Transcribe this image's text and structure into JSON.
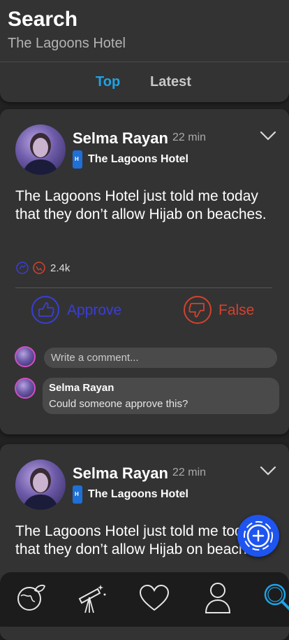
{
  "header": {
    "title": "Search",
    "query": "The Lagoons Hotel",
    "tabs": [
      {
        "label": "Top",
        "active": true
      },
      {
        "label": "Latest",
        "active": false
      }
    ]
  },
  "posts": [
    {
      "author": "Selma Rayan",
      "time": "22 min",
      "hotel": "The Lagoons Hotel",
      "text": "The Lagoons Hotel just told me today that they don’t allow Hijab on beaches.",
      "reaction_count": "2.4k",
      "approve_label": "Approve",
      "false_label": "False",
      "comment_placeholder": "Write a comment...",
      "comments": [
        {
          "author": "Selma Rayan",
          "text": "Could someone approve this?"
        }
      ]
    },
    {
      "author": "Selma Rayan",
      "time": "22 min",
      "hotel": "The Lagoons Hotel",
      "text": "The Lagoons Hotel just told me today that they don’t allow Hijab on beaches."
    }
  ],
  "hotel_badge_letter": "H",
  "nav": [
    {
      "icon": "globe-leaf-icon",
      "active": false
    },
    {
      "icon": "telescope-icon",
      "active": false
    },
    {
      "icon": "heart-icon",
      "active": false
    },
    {
      "icon": "profile-icon",
      "active": false
    },
    {
      "icon": "search-icon",
      "active": true
    }
  ],
  "colors": {
    "accent": "#1ea3e6",
    "approve": "#3a3ed8",
    "false": "#d4422e",
    "fab": "#1e55f0",
    "card": "#333333",
    "background": "#222222"
  }
}
